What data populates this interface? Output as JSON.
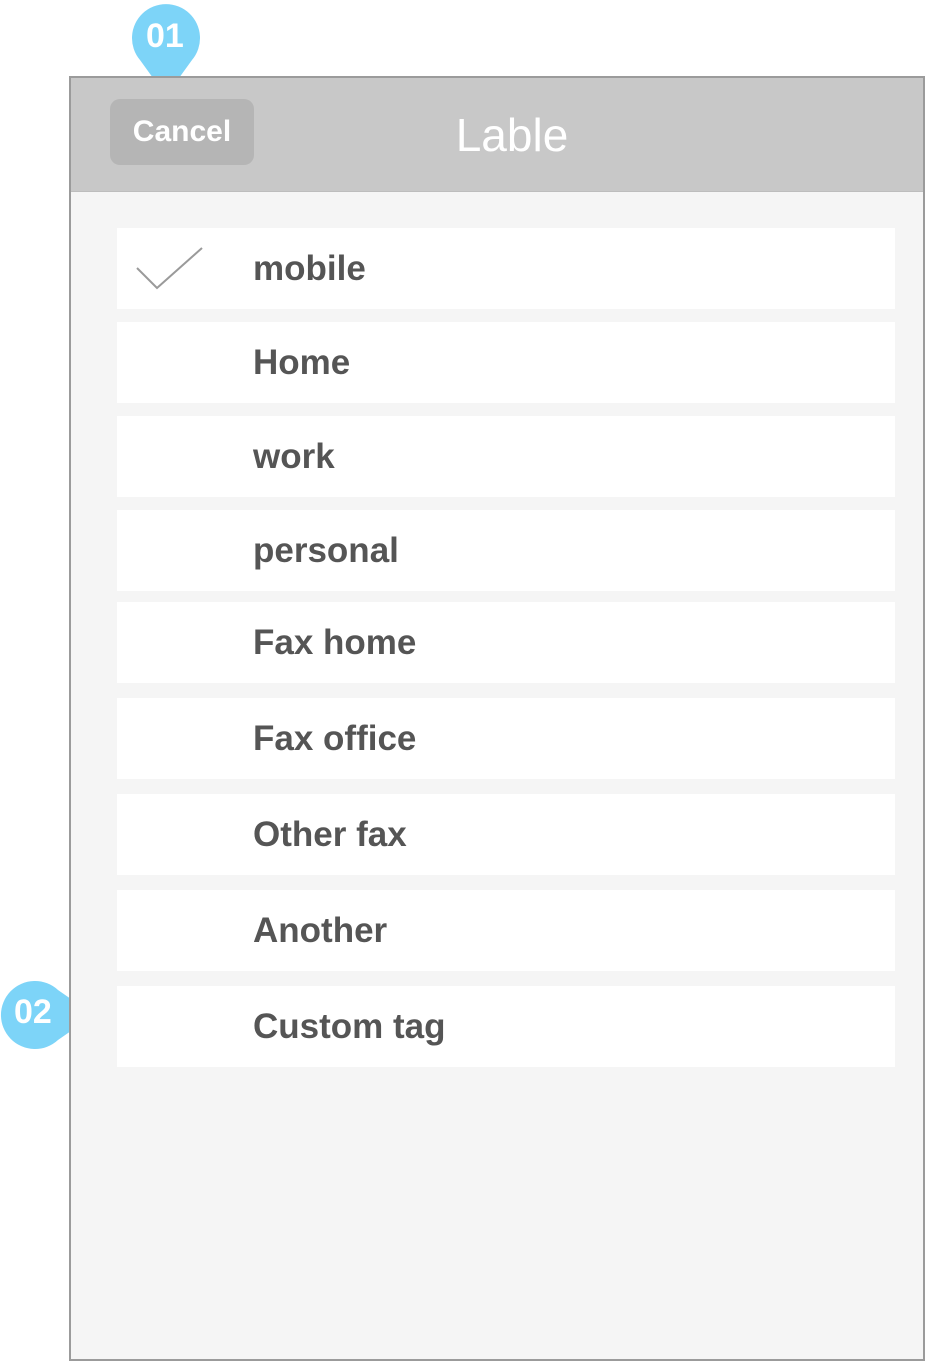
{
  "header": {
    "title": "Lable",
    "cancel_label": "Cancel"
  },
  "annotations": {
    "badge_1": "01",
    "badge_2": "02",
    "color": "#7dd4f8"
  },
  "labels": {
    "selected": "mobile",
    "items": [
      "mobile",
      "Home",
      "work",
      "personal",
      "Fax home",
      "Fax office",
      "Other fax",
      "Another",
      "Custom tag"
    ]
  },
  "icons": {
    "checkmark": "check-icon"
  }
}
